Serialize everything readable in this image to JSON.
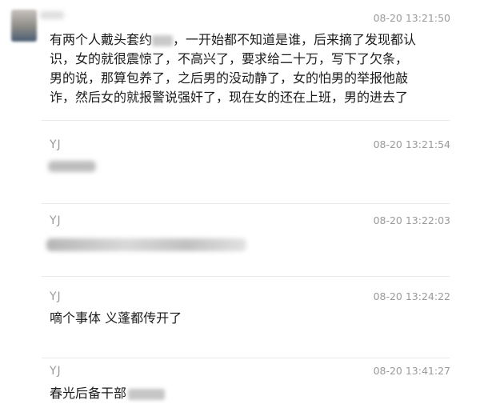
{
  "messages": [
    {
      "time": "08-20 13:21:50",
      "lines": [
        "有两个人戴头套约",
        "，一开始都不知道是谁，后来摘了发现都认",
        "识，女的就很震惊了，不高兴了，要求给二十万，写下了欠条，",
        "男的说，那算包养了，之后男的没动静了，女的怕男的举报他敲",
        "诈，然后女的就报警说强奸了，现在女的还在上班，男的进去了"
      ]
    },
    {
      "sender": "YJ",
      "time": "08-20 13:21:54",
      "text": ""
    },
    {
      "sender": "YJ",
      "time": "08-20 13:22:03",
      "text": ""
    },
    {
      "sender": "YJ",
      "time": "08-20 13:24:22",
      "text": "嘀个事体 义蓬都传开了"
    },
    {
      "sender": "YJ",
      "time": "08-20 13:41:27",
      "text": "春光后备干部"
    }
  ],
  "colors": {
    "background": "#ffffff",
    "meta_text": "#9a9a9a",
    "body_text": "#1b1b1b",
    "divider": "#e9e9e9"
  },
  "icons": {
    "avatar": "blurred-profile-photo"
  }
}
